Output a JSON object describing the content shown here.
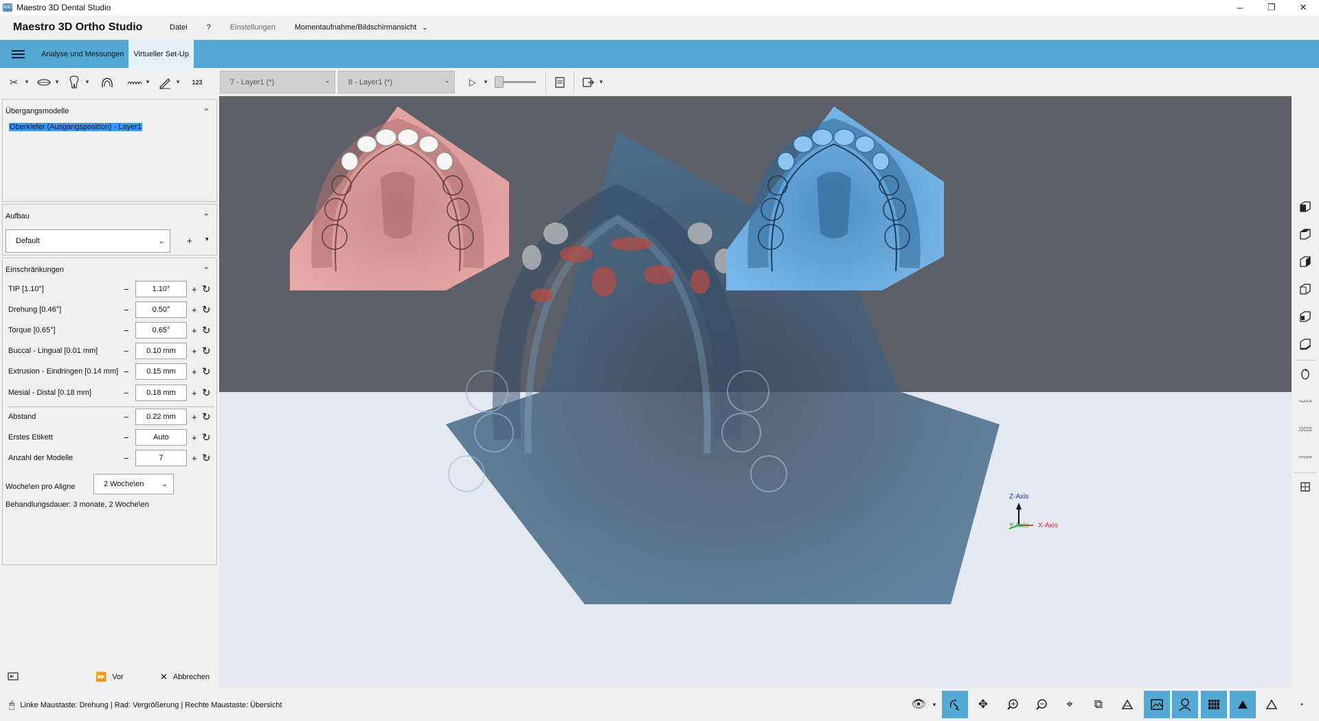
{
  "window": {
    "title": "Maestro 3D Dental Studio",
    "icon_text": "M3D",
    "min": "─",
    "restore": "❐",
    "close": "✕"
  },
  "menu": {
    "app_title": "Maestro 3D Ortho Studio",
    "items": [
      "Datei",
      "?",
      "Einstellungen",
      "Momentaufnahme/Bildschirmansicht"
    ]
  },
  "tabs": [
    {
      "label": "Analyse und Messungen"
    },
    {
      "label": "Virtueller Set-Up"
    }
  ],
  "toolbar": {
    "count_label": "123",
    "combo1": "7 - Layer1 (*)",
    "combo2": "8 - Layer1 (*)"
  },
  "panels": {
    "transition": {
      "title": "Übergangsmodelle",
      "item": "Oberkiefer (Ausgangsposition) - Layer1"
    },
    "setup": {
      "title": "Aufbau",
      "value": "Default",
      "add": "+"
    },
    "constraints": {
      "title": "Einschränkungen",
      "rows": [
        {
          "label": "TIP [1.10°]",
          "value": "1.10°"
        },
        {
          "label": "Drehung [0.46°]",
          "value": "0.50°"
        },
        {
          "label": "Torque [0.65°]",
          "value": "0.65°"
        },
        {
          "label": "Buccal - Lingual [0.01 mm]",
          "value": "0.10 mm"
        },
        {
          "label": "Extrusion - Eindringen [0.14 mm]",
          "value": "0.15 mm"
        },
        {
          "label": "Mesial - Distal [0.18 mm]",
          "value": "0.18 mm"
        },
        {
          "label": "Abstand",
          "value": "0.22 mm"
        },
        {
          "label": "Erstes Etikett",
          "value": "Auto"
        },
        {
          "label": "Anzahl der Modelle",
          "value": "7"
        }
      ],
      "weeks_label": "Woche\\en pro Aligne",
      "weeks_value": "2 Woche\\en",
      "duration": "Behandlungsdauer: 3 monate, 2 Woche\\en"
    }
  },
  "nav": {
    "next": "Vor",
    "cancel": "Abbrechen"
  },
  "axes": {
    "z": "Z-Axis",
    "y": "Y-Axis",
    "x": "X-Axis"
  },
  "status": {
    "text": "Linke Maustaste: Drehung | Rad: Vergrößerung | Rechte Maustaste: Übersicht"
  },
  "colors": {
    "accent": "#54a8d4",
    "viewport_top": "#5d6068",
    "viewport_bottom": "#e4e8f1",
    "upper_model": "#e8a8a6",
    "lower_model": "#6fb2e8"
  }
}
